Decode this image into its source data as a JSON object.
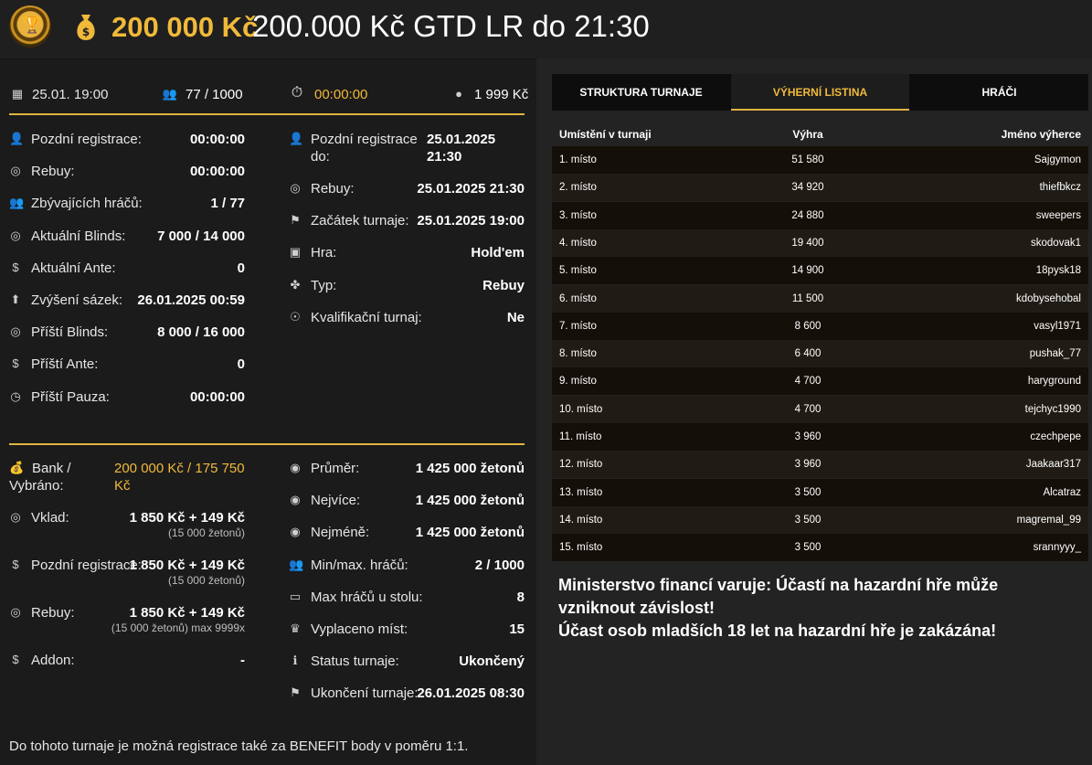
{
  "header": {
    "amount": "200 000 Kč",
    "title": "200.000 Kč GTD LR do 21:30"
  },
  "topbar": {
    "date": "25.01. 19:00",
    "players": "77 / 1000",
    "timer": "00:00:00",
    "buyin": "1 999 Kč"
  },
  "left_col": [
    {
      "label": "Pozdní registrace:",
      "value": "00:00:00",
      "icon": "user-icon"
    },
    {
      "label": "Rebuy:",
      "value": "00:00:00",
      "icon": "coins-icon"
    },
    {
      "label": "Zbývajících hráčů:",
      "value": "1 / 77",
      "icon": "users-icon"
    },
    {
      "label": "Aktuální Blinds:",
      "value": "7 000 / 14 000",
      "icon": "coins-icon"
    },
    {
      "label": "Aktuální Ante:",
      "value": "0",
      "icon": "dollar-icon"
    },
    {
      "label": "Zvýšení sázek:",
      "value": "26.01.2025 00:59",
      "icon": "arrow-up-icon"
    },
    {
      "label": "Příští Blinds:",
      "value": "8 000 / 16 000",
      "icon": "coins-icon"
    },
    {
      "label": "Příští Ante:",
      "value": "0",
      "icon": "dollar-icon"
    },
    {
      "label": "Příští Pauza:",
      "value": "00:00:00",
      "icon": "clock-icon"
    }
  ],
  "mid_col": {
    "late_reg_label1": "Pozdní registrace",
    "late_reg_label2": "do:",
    "late_reg_value1": "25.01.2025",
    "late_reg_value2": "21:30",
    "rows": [
      {
        "label": "Rebuy:",
        "value": "25.01.2025 21:30",
        "icon": "coins-icon"
      },
      {
        "label": "Začátek turnaje:",
        "value": "25.01.2025 19:00",
        "icon": "flag-icon"
      },
      {
        "label": "Hra:",
        "value": "Hold'em",
        "icon": "cards-icon"
      },
      {
        "label": "Typ:",
        "value": "Rebuy",
        "icon": "clubs-icon"
      },
      {
        "label": "Kvalifikační turnaj:",
        "value": "Ne",
        "icon": "medal-icon"
      }
    ]
  },
  "bank": {
    "label1": "Bank /",
    "label2": "Vybráno:",
    "value1": "200 000 Kč / 175 750",
    "value2": "Kč"
  },
  "fees": [
    {
      "label": "Vklad:",
      "value": "1 850 Kč + 149 Kč",
      "sub": "(15 000 žetonů)",
      "icon": "coins-icon"
    },
    {
      "label": "Pozdní registrace:",
      "value": "1 850 Kč + 149 Kč",
      "sub": "(15 000 žetonů)",
      "icon": "dollar-icon"
    },
    {
      "label": "Rebuy:",
      "value": "1 850 Kč + 149 Kč",
      "sub": "(15 000 žetonů) max 9999x",
      "icon": "coins-icon"
    },
    {
      "label": "Addon:",
      "value": "-",
      "sub": "",
      "icon": "dollar-icon"
    }
  ],
  "stats": [
    {
      "label": "Průměr:",
      "value": "1 425 000 žetonů",
      "icon": "chip-icon"
    },
    {
      "label": "Nejvíce:",
      "value": "1 425 000 žetonů",
      "icon": "chip-icon"
    },
    {
      "label": "Nejméně:",
      "value": "1 425 000 žetonů",
      "icon": "chip-icon"
    },
    {
      "label": "Min/max. hráčů:",
      "value": "2 / 1000",
      "icon": "users-icon"
    },
    {
      "label": "Max hráčů u stolu:",
      "value": "8",
      "icon": "table-icon"
    },
    {
      "label": "Vyplaceno míst:",
      "value": "15",
      "icon": "award-icon"
    },
    {
      "label": "Status turnaje:",
      "value": "Ukončený",
      "icon": "info-icon"
    },
    {
      "label": "Ukončení turnaje:",
      "value": "26.01.2025 08:30",
      "icon": "flag-icon"
    }
  ],
  "footer_note": "Do tohoto turnaje je možná registrace také za BENEFIT body v poměru 1:1.",
  "tabs": [
    "STRUKTURA TURNAJE",
    "VÝHERNÍ LISTINA",
    "HRÁČI"
  ],
  "table": {
    "headers": [
      "Umístění v turnaji",
      "Výhra",
      "Jméno výherce"
    ],
    "rows": [
      [
        "1. místo",
        "51 580",
        "Sajgymon"
      ],
      [
        "2. místo",
        "34 920",
        "thiefbkcz"
      ],
      [
        "3. místo",
        "24 880",
        "sweepers"
      ],
      [
        "4. místo",
        "19 400",
        "skodovak1"
      ],
      [
        "5. místo",
        "14 900",
        "18pysk18"
      ],
      [
        "6. místo",
        "11 500",
        "kdobysehobal"
      ],
      [
        "7. místo",
        "8 600",
        "vasyl1971"
      ],
      [
        "8. místo",
        "6 400",
        "pushak_77"
      ],
      [
        "9. místo",
        "4 700",
        "haryground"
      ],
      [
        "10. místo",
        "4 700",
        "tejchyc1990"
      ],
      [
        "11. místo",
        "3 960",
        "czechpepe"
      ],
      [
        "12. místo",
        "3 960",
        "Jaakaar317"
      ],
      [
        "13. místo",
        "3 500",
        "Alcatraz"
      ],
      [
        "14. místo",
        "3 500",
        "magremal_99"
      ],
      [
        "15. místo",
        "3 500",
        "srannyyy_"
      ]
    ]
  },
  "warning_line1": "Ministerstvo financí varuje: Účastí na hazardní hře může vzniknout závislost!",
  "warning_line2": "Účast osob mladších 18 let na hazardní hře je zakázána!"
}
